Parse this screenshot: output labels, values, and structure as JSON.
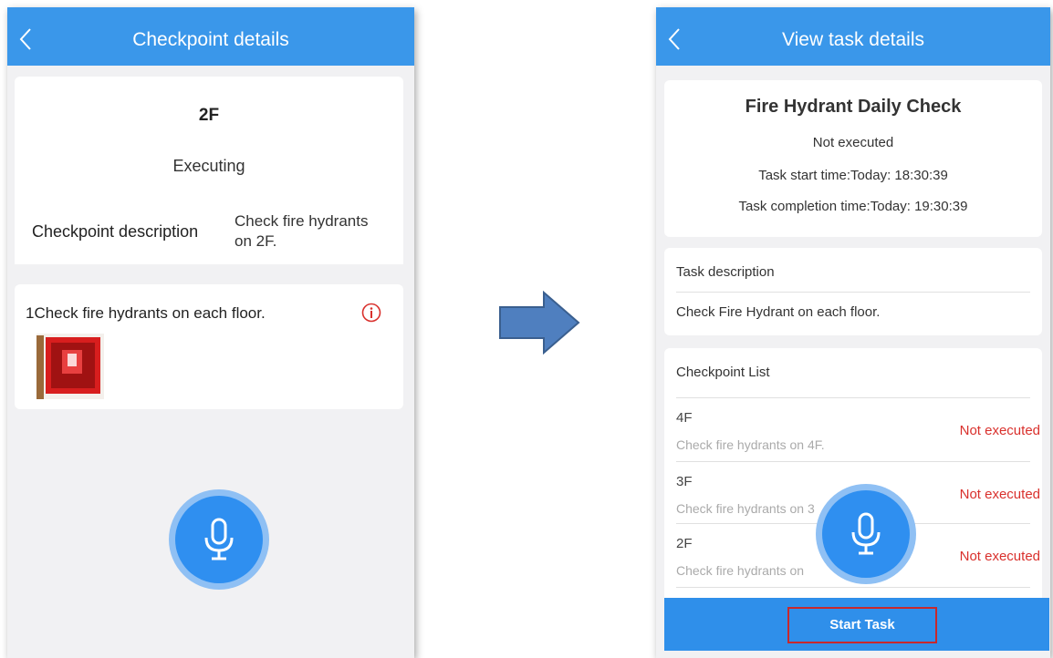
{
  "left_screen": {
    "title": "Checkpoint details",
    "floor": "2F",
    "status": "Executing",
    "description_label": "Checkpoint description",
    "description_value": "Check fire hydrants on 2F.",
    "item_text": "1Check fire hydrants on each floor."
  },
  "right_screen": {
    "title": "View task details",
    "task_title": "Fire Hydrant Daily Check",
    "task_status": "Not executed",
    "task_start_time": "Task start time:Today: 18:30:39",
    "task_completion_time": "Task completion time:Today: 19:30:39",
    "task_description_label": "Task description",
    "task_description_value": "Check Fire Hydrant on each floor.",
    "checkpoint_list_label": "Checkpoint List",
    "checkpoints": [
      {
        "name": "4F",
        "description": "Check fire hydrants on 4F.",
        "status": "Not executed"
      },
      {
        "name": "3F",
        "description": "Check fire hydrants on 3",
        "status": "Not executed"
      },
      {
        "name": "2F",
        "description": "Check fire hydrants on",
        "status": "Not executed"
      }
    ],
    "start_button_label": "Start Task"
  },
  "icons": {
    "back": "back-chevron-icon",
    "info": "info-circle-icon",
    "mic": "microphone-icon",
    "arrow": "right-arrow-icon"
  },
  "colors": {
    "topbar": "#3a97ea",
    "status_red": "#d9302c",
    "mic_blue": "#2f8ff0",
    "button_highlight": "#c8282c"
  }
}
